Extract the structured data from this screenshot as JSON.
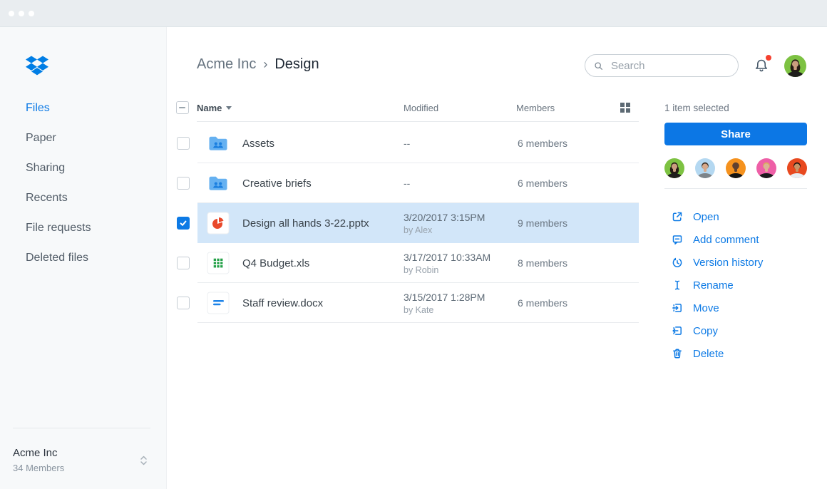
{
  "topbar": {
    "window_controls": [
      "close",
      "minimize",
      "zoom"
    ]
  },
  "sidebar": {
    "nav": [
      {
        "label": "Files",
        "active": true
      },
      {
        "label": "Paper",
        "active": false
      },
      {
        "label": "Sharing",
        "active": false
      },
      {
        "label": "Recents",
        "active": false
      },
      {
        "label": "File requests",
        "active": false
      },
      {
        "label": "Deleted files",
        "active": false
      }
    ],
    "team": {
      "name": "Acme Inc",
      "members": "34 Members"
    }
  },
  "header": {
    "breadcrumb": {
      "parent": "Acme Inc",
      "separator": "›",
      "current": "Design"
    },
    "search": {
      "placeholder": "Search"
    },
    "notification_unread": true
  },
  "table": {
    "header": {
      "name": "Name",
      "modified": "Modified",
      "members": "Members"
    },
    "rows": [
      {
        "name": "Assets",
        "type": "folder",
        "modified": "--",
        "modified_by": "",
        "members": "6 members",
        "selected": false
      },
      {
        "name": "Creative briefs",
        "type": "folder",
        "modified": "--",
        "modified_by": "",
        "members": "6 members",
        "selected": false
      },
      {
        "name": "Design all hands 3-22.pptx",
        "type": "presentation",
        "modified": "3/20/2017 3:15PM",
        "modified_by": "by Alex",
        "members": "9 members",
        "selected": true
      },
      {
        "name": "Q4 Budget.xls",
        "type": "spreadsheet",
        "modified": "3/17/2017 10:33AM",
        "modified_by": "by Robin",
        "members": "8 members",
        "selected": false
      },
      {
        "name": "Staff review.docx",
        "type": "document",
        "modified": "3/15/2017 1:28PM",
        "modified_by": "by Kate",
        "members": "6 members",
        "selected": false
      }
    ]
  },
  "details": {
    "status": "1 item selected",
    "share_label": "Share",
    "avatars": [
      {
        "bg": "#7dc242",
        "skin": "#c99d7f",
        "hair": "#241b14",
        "shirt": "#1f1e1c",
        "backhair": "#241b14"
      },
      {
        "bg": "#b4d8f1",
        "skin": "#d8a98a",
        "hair": "#35291f",
        "shirt": "#7d8489",
        "backhair": "transparent"
      },
      {
        "bg": "#f5921e",
        "skin": "#5f4030",
        "hair": "#5f4030",
        "shirt": "#141414",
        "backhair": "transparent"
      },
      {
        "bg": "#ee5fa7",
        "skin": "#dcb294",
        "hair": "#d9aa5c",
        "shirt": "#1a1a1c",
        "backhair": "transparent"
      },
      {
        "bg": "#e8491f",
        "skin": "#c89467",
        "hair": "#12100d",
        "shirt": "#e8edf1",
        "backhair": "transparent"
      }
    ],
    "actions": [
      {
        "label": "Open",
        "icon": "open"
      },
      {
        "label": "Add comment",
        "icon": "comment"
      },
      {
        "label": "Version history",
        "icon": "history"
      },
      {
        "label": "Rename",
        "icon": "rename"
      },
      {
        "label": "Move",
        "icon": "move"
      },
      {
        "label": "Copy",
        "icon": "copy"
      },
      {
        "label": "Delete",
        "icon": "delete"
      }
    ]
  },
  "colors": {
    "accent": "#0d7ae5",
    "selected_row": "#d2e6f9",
    "share_button": "#0c77e5",
    "notification_dot": "#f5402f",
    "logo_blue": "#007ee5"
  }
}
